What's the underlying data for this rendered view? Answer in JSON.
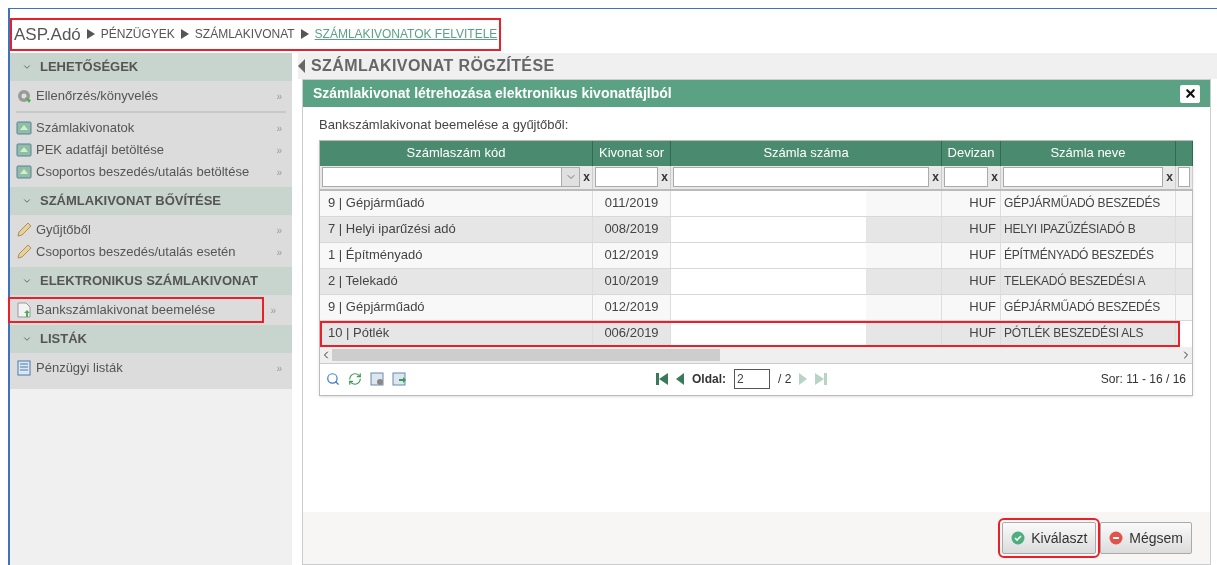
{
  "breadcrumb": {
    "highlighted": true,
    "items": [
      {
        "label": "ASP.Adó",
        "kind": "root"
      },
      {
        "label": "PÉNZÜGYEK",
        "kind": "crumb"
      },
      {
        "label": "SZÁMLAKIVONAT",
        "kind": "crumb"
      },
      {
        "label": "SZÁMLAKIVONATOK FELVITELE",
        "kind": "current"
      }
    ]
  },
  "sidebar": {
    "sections": [
      {
        "title": "LEHETŐSÉGEK",
        "groups": [
          [
            {
              "label": "Ellenőrzés/könyvelés",
              "kind": "booking",
              "more": "»",
              "highlighted": false
            }
          ],
          [
            {
              "label": "Számlakivonatok",
              "kind": "statement",
              "more": "»",
              "highlighted": false
            },
            {
              "label": "PEK adatfájl betöltése",
              "kind": "statement",
              "more": "»",
              "highlighted": false
            },
            {
              "label": "Csoportos beszedés/utalás betöltése",
              "kind": "statement",
              "more": "»",
              "highlighted": false
            }
          ]
        ]
      },
      {
        "title": "SZÁMLAKIVONAT BŐVÍTÉSE",
        "groups": [
          [
            {
              "label": "Gyűjtőből",
              "kind": "extension",
              "more": "»",
              "highlighted": false
            },
            {
              "label": "Csoportos beszedés/utalás esetén",
              "kind": "extension",
              "more": "»",
              "highlighted": false
            }
          ]
        ]
      },
      {
        "title": "ELEKTRONIKUS SZÁMLAKIVONAT",
        "groups": [
          [
            {
              "label": "Bankszámlakivonat beemelése",
              "kind": "import",
              "more": "»",
              "highlighted": true
            }
          ]
        ]
      },
      {
        "title": "LISTÁK",
        "groups": [
          [
            {
              "label": "Pénzügyi listák",
              "kind": "listing",
              "more": "»",
              "highlighted": false
            }
          ]
        ]
      }
    ]
  },
  "page_title": "SZÁMLAKIVONAT RÖGZÍTÉSE",
  "dialog": {
    "title": "Számlakivonat létrehozása elektronikus kivonatfájlból",
    "subtitle": "Bankszámlakivonat beemelése a gyűjtőből:",
    "table": {
      "columns": [
        {
          "label": "Számlaszám kód",
          "clear": "x",
          "dropdown": true
        },
        {
          "label": "Kivonat sor",
          "clear": "x",
          "dropdown": false
        },
        {
          "label": "Számla száma",
          "clear": "x",
          "dropdown": false
        },
        {
          "label": "Devizan",
          "clear": "x",
          "dropdown": false
        },
        {
          "label": "Számla neve",
          "clear": "x",
          "dropdown": false
        },
        {
          "dropdown": false
        }
      ],
      "rows": [
        {
          "code": "9 | Gépjárműadó",
          "line": "011/2019",
          "currency": "HUF",
          "name": "GÉPJÁRMŰADÓ BESZEDÉS",
          "highlighted": false
        },
        {
          "code": "7 | Helyi iparűzési adó",
          "line": "008/2019",
          "currency": "HUF",
          "name": "HELYI IPAZŰZÉSIADÓ B",
          "highlighted": false
        },
        {
          "code": "1 | Építményadó",
          "line": "012/2019",
          "currency": "HUF",
          "name": "ÉPÍTMÉNYADÓ BESZEDÉS",
          "highlighted": false
        },
        {
          "code": "2 | Telekadó",
          "line": "010/2019",
          "currency": "HUF",
          "name": "TELEKADÓ BESZEDÉSI A",
          "highlighted": false
        },
        {
          "code": "9 | Gépjárműadó",
          "line": "012/2019",
          "currency": "HUF",
          "name": "GÉPJÁRMŰADÓ BESZEDÉS",
          "highlighted": false
        },
        {
          "code": "10 | Pótlék",
          "line": "006/2019",
          "currency": "HUF",
          "name": "PÓTLÉK BESZEDÉSI ALS",
          "highlighted": true
        }
      ]
    },
    "pager": {
      "page_label": "Oldal:",
      "page": "2",
      "total": "/ 2",
      "rows_info": "Sor: 11 - 16 / 16"
    },
    "buttons": [
      {
        "label": "Kiválaszt",
        "kind": "ok",
        "highlighted": true
      },
      {
        "label": "Mégsem",
        "kind": "cancel",
        "highlighted": false
      }
    ]
  }
}
